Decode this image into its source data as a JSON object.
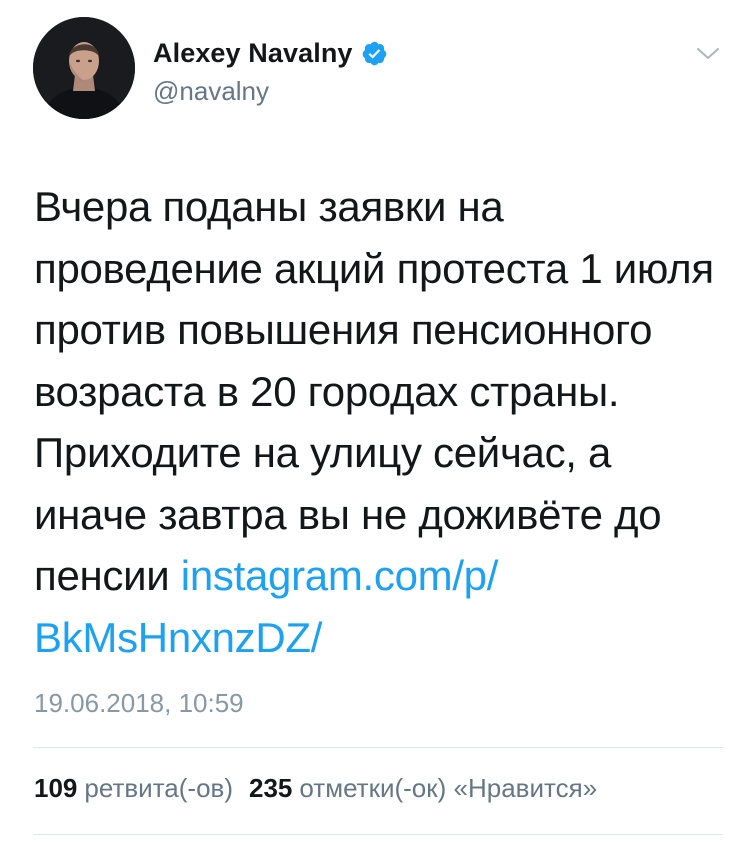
{
  "author": {
    "display_name": "Alexey Navalny",
    "handle": "@navalny",
    "verified": true
  },
  "tweet": {
    "text_lines": [
      "Вчера поданы заявки на",
      "проведение акций протеста 1 июля",
      "против повышения пенсионного",
      "возраста в 20 городах страны.",
      "Приходите на улицу сейчас, а",
      "иначе завтра вы не доживёте до"
    ],
    "last_line_prefix": "пенсии ",
    "link_part1": "instagram.com/p/",
    "link_part2": "BkMsHnxnzDZ/",
    "timestamp": "19.06.2018, 10:59"
  },
  "stats": {
    "retweets_count": "109",
    "retweets_label": "ретвита(-ов)",
    "likes_count": "235",
    "likes_label": "отметки(-ок) «Нравится»"
  },
  "icons": {
    "verified": "verified-badge-icon",
    "menu": "chevron-down-icon"
  },
  "colors": {
    "link": "#1da1f2",
    "verified": "#1da1f2",
    "secondary_text": "#657786",
    "timestamp": "#8899a6",
    "divider": "#e1e8ed"
  }
}
